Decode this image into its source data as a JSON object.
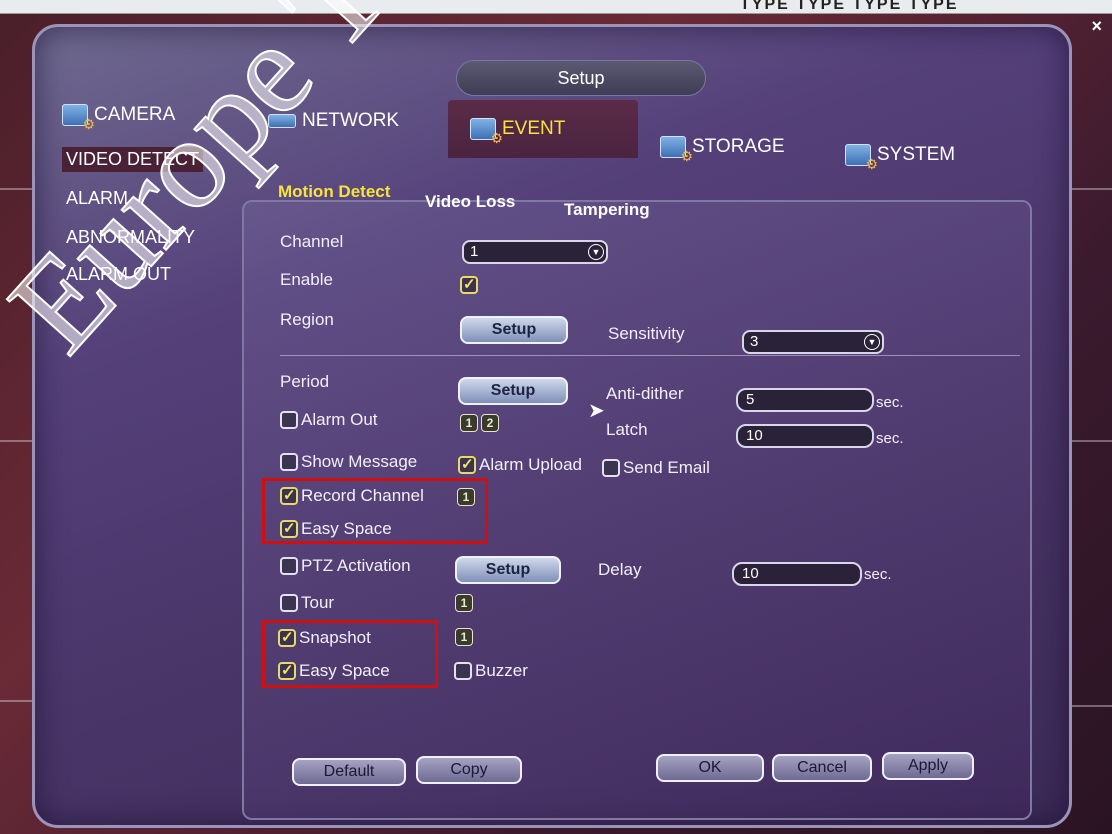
{
  "close_glyph": "×",
  "top_strip_text": "TYPE TYPE TYPE TYPE",
  "dialog": {
    "title": "Setup"
  },
  "main_tabs": [
    {
      "label": "CAMERA"
    },
    {
      "label": "NETWORK"
    },
    {
      "label": "EVENT"
    },
    {
      "label": "STORAGE"
    },
    {
      "label": "SYSTEM"
    }
  ],
  "sidebar": {
    "items": [
      {
        "label": "VIDEO DETECT"
      },
      {
        "label": "ALARM"
      },
      {
        "label": "ABNORMALITY"
      },
      {
        "label": "ALARM OUT"
      }
    ]
  },
  "sub_tabs": [
    {
      "label": "Motion Detect"
    },
    {
      "label": "Video Loss"
    },
    {
      "label": "Tampering"
    }
  ],
  "form": {
    "channel_label": "Channel",
    "channel_value": "1",
    "enable_label": "Enable",
    "region_label": "Region",
    "region_button": "Setup",
    "sensitivity_label": "Sensitivity",
    "sensitivity_value": "3",
    "period_label": "Period",
    "period_button": "Setup",
    "anti_dither_label": "Anti-dither",
    "anti_dither_value": "5",
    "latch_label": "Latch",
    "latch_value": "10",
    "sec_label": "sec.",
    "alarm_out_label": "Alarm Out",
    "alarm_out_badges": [
      "1",
      "2"
    ],
    "show_message_label": "Show Message",
    "alarm_upload_label": "Alarm Upload",
    "send_email_label": "Send Email",
    "record_channel_label": "Record Channel",
    "record_channel_badge": "1",
    "easy_space_label": "Easy Space",
    "ptz_label": "PTZ Activation",
    "ptz_button": "Setup",
    "delay_label": "Delay",
    "delay_value": "10",
    "tour_label": "Tour",
    "tour_badge": "1",
    "snapshot_label": "Snapshot",
    "snapshot_badge": "1",
    "buzzer_label": "Buzzer"
  },
  "footer": {
    "default": "Default",
    "copy": "Copy",
    "ok": "OK",
    "cancel": "Cancel",
    "apply": "Apply"
  },
  "watermark": "Europe Technical"
}
